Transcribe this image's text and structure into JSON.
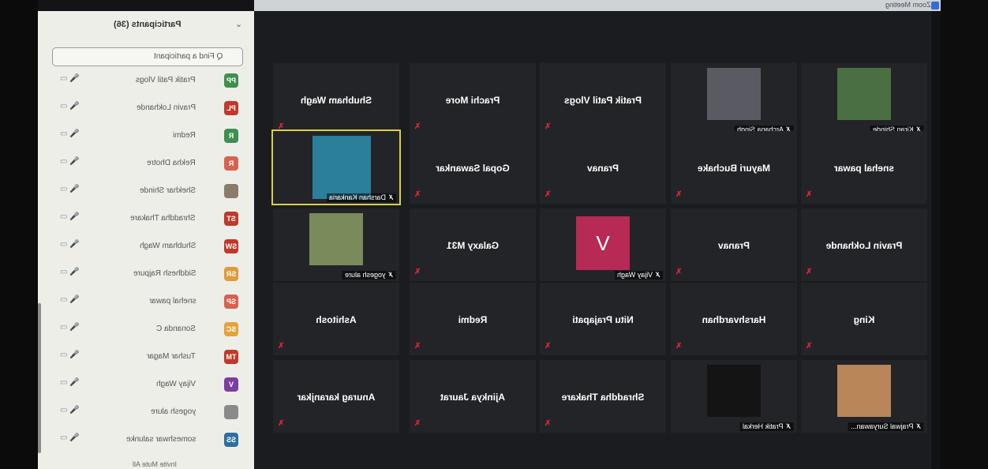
{
  "window": {
    "title": "Zoom Meeting"
  },
  "participants_panel": {
    "title": "Participants (36)",
    "search_placeholder": "Q Find a participant",
    "footer": "Invite      Mute All",
    "items": [
      {
        "initials": "PP",
        "name": "Pratik Patil Vlogs",
        "color": "#3f8f4f"
      },
      {
        "initials": "PL",
        "name": "Pravin Lokhande",
        "color": "#c0392b"
      },
      {
        "initials": "R",
        "name": "Redmi",
        "color": "#3f8f4f"
      },
      {
        "initials": "R",
        "name": "Rekha Dhotre",
        "color": "#d9614f"
      },
      {
        "initials": "",
        "name": "Shekhar Shinde",
        "color": "#8a7b6b"
      },
      {
        "initials": "ST",
        "name": "Shraddha Thakare",
        "color": "#c0392b"
      },
      {
        "initials": "SW",
        "name": "Shubham Wagh",
        "color": "#c0392b"
      },
      {
        "initials": "SR",
        "name": "Siddhesh Rajpure",
        "color": "#e39a3b"
      },
      {
        "initials": "SP",
        "name": "snehal pawar",
        "color": "#d9614f"
      },
      {
        "initials": "SC",
        "name": "Sonanda C",
        "color": "#e3a33b"
      },
      {
        "initials": "TM",
        "name": "Tushar Magar",
        "color": "#c0392b"
      },
      {
        "initials": "V",
        "name": "Vijay Wagh",
        "color": "#7b3fa0"
      },
      {
        "initials": "",
        "name": "yogesh alure",
        "color": "#8a8a8a"
      },
      {
        "initials": "SS",
        "name": "someshwar salunke",
        "color": "#2f6fa0"
      }
    ]
  },
  "grid": {
    "row1": [
      {
        "name": "Kiran Shinde",
        "type": "video"
      },
      {
        "name": "Archana Singh",
        "type": "video"
      },
      {
        "name": "Pratik Patil Vlogs",
        "type": "name"
      },
      {
        "name": "Prachi More",
        "type": "name"
      },
      {
        "name": "Shubham Wagh",
        "type": "name"
      }
    ],
    "row2": [
      {
        "name": "snehal pawar",
        "type": "name"
      },
      {
        "name": "Mayuri Buchake",
        "type": "name"
      },
      {
        "name": "Pranav",
        "type": "name"
      },
      {
        "name": "Gopal Sawankar",
        "type": "name"
      },
      {
        "name": "Darshan Kankaria",
        "type": "video"
      }
    ],
    "row3": [
      {
        "name": "Pravin Lokhande",
        "type": "name"
      },
      {
        "name": "Pranav",
        "type": "name"
      },
      {
        "name": "Vijay Wagh",
        "type": "avatar",
        "initial": "V"
      },
      {
        "name": "Galaxy M31",
        "type": "name"
      },
      {
        "name": "yogesh alure",
        "type": "video"
      }
    ],
    "row4": [
      {
        "name": "King",
        "type": "name"
      },
      {
        "name": "Harshvardhan",
        "type": "name"
      },
      {
        "name": "Nitu Prajapati",
        "type": "name"
      },
      {
        "name": "Redmi",
        "type": "name"
      },
      {
        "name": "Ashitosh",
        "type": "name"
      }
    ],
    "row5": [
      {
        "name": "Prajwal Suryawan...",
        "type": "video"
      },
      {
        "name": "Pratik Herkal",
        "type": "video"
      },
      {
        "name": "Shraddha Thakare",
        "type": "name"
      },
      {
        "name": "Ajinkya Jaurat",
        "type": "name"
      },
      {
        "name": "Anurag karanjkar",
        "type": "name"
      }
    ]
  }
}
